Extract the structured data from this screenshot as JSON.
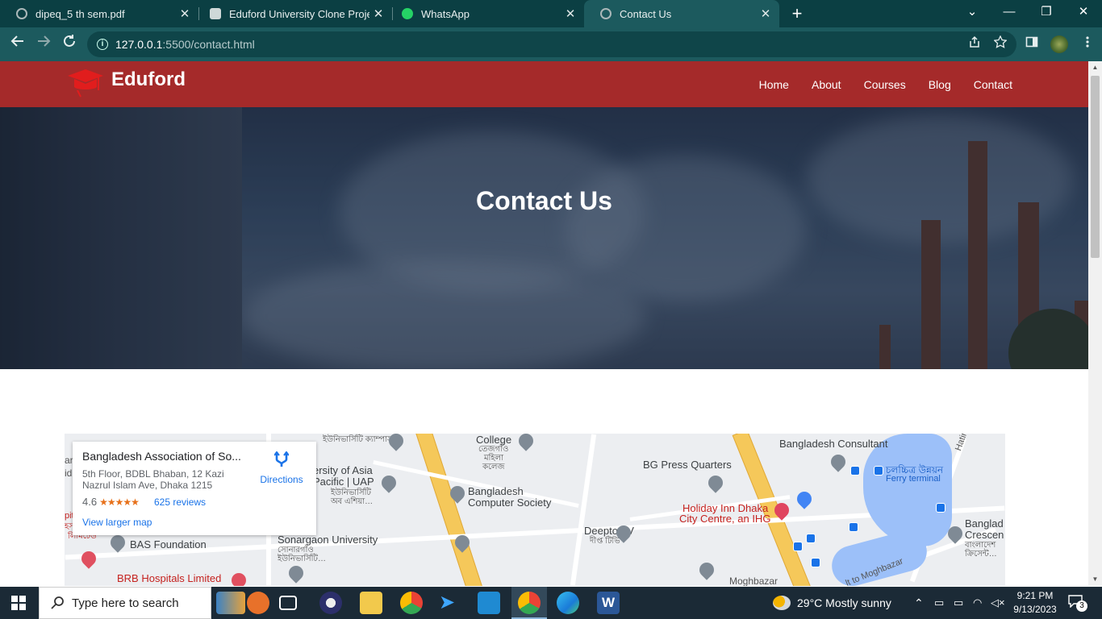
{
  "browser": {
    "tabs": [
      {
        "title": "dipeq_5 th sem.pdf",
        "icon": "globe-icon",
        "active": false
      },
      {
        "title": "Eduford University Clone Project",
        "icon": "site-icon",
        "active": false
      },
      {
        "title": "WhatsApp",
        "icon": "whatsapp-icon",
        "active": false
      },
      {
        "title": "Contact Us",
        "icon": "globe-icon",
        "active": true
      }
    ],
    "close_glyph": "✕",
    "new_tab_glyph": "+",
    "url_host": "127.0.0.1",
    "url_rest": ":5500/contact.html",
    "controls": {
      "dropdown": "⌄",
      "minimize": "—",
      "restore": "❐",
      "close": "✕"
    }
  },
  "site": {
    "brand": "Eduford",
    "nav": [
      "Home",
      "About",
      "Courses",
      "Blog",
      "Contact"
    ],
    "hero_title": "Contact Us",
    "colors": {
      "nav_bg": "#a52a2a",
      "logo_cap": "#e11d1d"
    }
  },
  "map": {
    "card": {
      "name": "Bangladesh Association of So...",
      "address": "5th Floor, BDBL Bhaban, 12 Kazi Nazrul Islam Ave, Dhaka 1215",
      "rating": "4.6",
      "stars": "★★★★★",
      "reviews": "625 reviews",
      "directions": "Directions",
      "larger_map": "View larger map"
    },
    "labels": {
      "college": "College",
      "college_bn1": "তেজগাঁও",
      "college_bn2": "মহিলা",
      "college_bn3": "কলেজ",
      "uni_asia1": "ersity of Asia",
      "uni_asia2": "Pacific | UAP",
      "uni_asia_bn": "ইউনিভার্সিটি",
      "uni_asia_bn2": "অব এশিয়া…",
      "top_bn": "ইউনিভার্সিটি ক্যাম্পাস",
      "bcs1": "Bangladesh",
      "bcs2": "Computer Society",
      "bg_press": "BG Press Quarters",
      "consultant": "Bangladesh Consultant",
      "film_bn": "চলচ্চিত্র উন্নয়ন",
      "ferry": "Ferry terminal",
      "hatir": "Hatir",
      "holiday1": "Holiday Inn Dhaka",
      "holiday2": "City Centre, an IHG",
      "deepto": "Deepto TV",
      "deepto_bn": "দীপ্ত টিভি",
      "bangl_cres1": "Banglad",
      "bangl_cres2": "Crescen",
      "bangl_cres_bn": "বাংলাদেশ",
      "bangl_cres_bn2": "ক্রিসেন্ট…",
      "sonargaon": "Sonargaon University",
      "sonargaon_bn": "সোনারগাঁও",
      "sonargaon_bn2": "ইউনিভার্সিটি…",
      "bas": "BAS Foundation",
      "brb": "BRB Hospitals Limited",
      "moghbazar": "Moghbazar",
      "to_moghbazar": "lt to Moghbazar",
      "left_frag1": "ar",
      "left_frag2": "id",
      "left_red1": "pit",
      "left_red2": "হসপিটাল",
      "left_red3": "লিমিটেড"
    }
  },
  "taskbar": {
    "search_placeholder": "Type here to search",
    "weather": "29°C  Mostly sunny",
    "time": "9:21 PM",
    "date": "9/13/2023",
    "notifications": "3"
  }
}
